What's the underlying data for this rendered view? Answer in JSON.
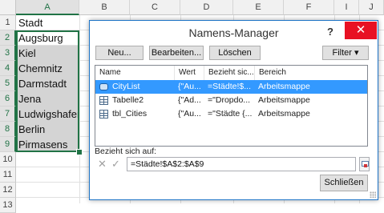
{
  "sheet": {
    "columns": [
      "A",
      "B",
      "C",
      "D",
      "E",
      "F",
      "I",
      "J"
    ],
    "rows": [
      "1",
      "2",
      "3",
      "4",
      "5",
      "6",
      "7",
      "8",
      "9",
      "10",
      "11",
      "12",
      "13"
    ],
    "cells": [
      "Stadt",
      "Augsburg",
      "Kiel",
      "Chemnitz",
      "Darmstadt",
      "Jena",
      "Ludwigshafen",
      "Berlin",
      "Pirmasens"
    ]
  },
  "dialog": {
    "title": "Namens-Manager",
    "help": "?",
    "close": "✕",
    "buttons": {
      "new": "Neu...",
      "edit": "Bearbeiten...",
      "delete": "Löschen",
      "filter": "Filter ▾"
    },
    "columns": {
      "name": "Name",
      "value": "Wert",
      "refers": "Bezieht sic...",
      "scope": "Bereich"
    },
    "rows": [
      {
        "name": "CityList",
        "value": "{\"Au...",
        "refers": "=Städte!$...",
        "scope": "Arbeitsmappe"
      },
      {
        "name": "Tabelle2",
        "value": "{\"Ad...",
        "refers": "=\"Dropdo...",
        "scope": "Arbeitsmappe"
      },
      {
        "name": "tbl_Cities",
        "value": "{\"Au...",
        "refers": "=\"Städte {...",
        "scope": "Arbeitsmappe"
      }
    ],
    "refers_label": "Bezieht sich auf:",
    "refers_value": "=Städte!$A$2:$A$9",
    "cancel_icon": "✕",
    "accept_icon": "✓",
    "close_button": "Schließen"
  },
  "colors": {
    "accent": "#217346",
    "selection": "#3399ff",
    "close": "#e81123"
  }
}
